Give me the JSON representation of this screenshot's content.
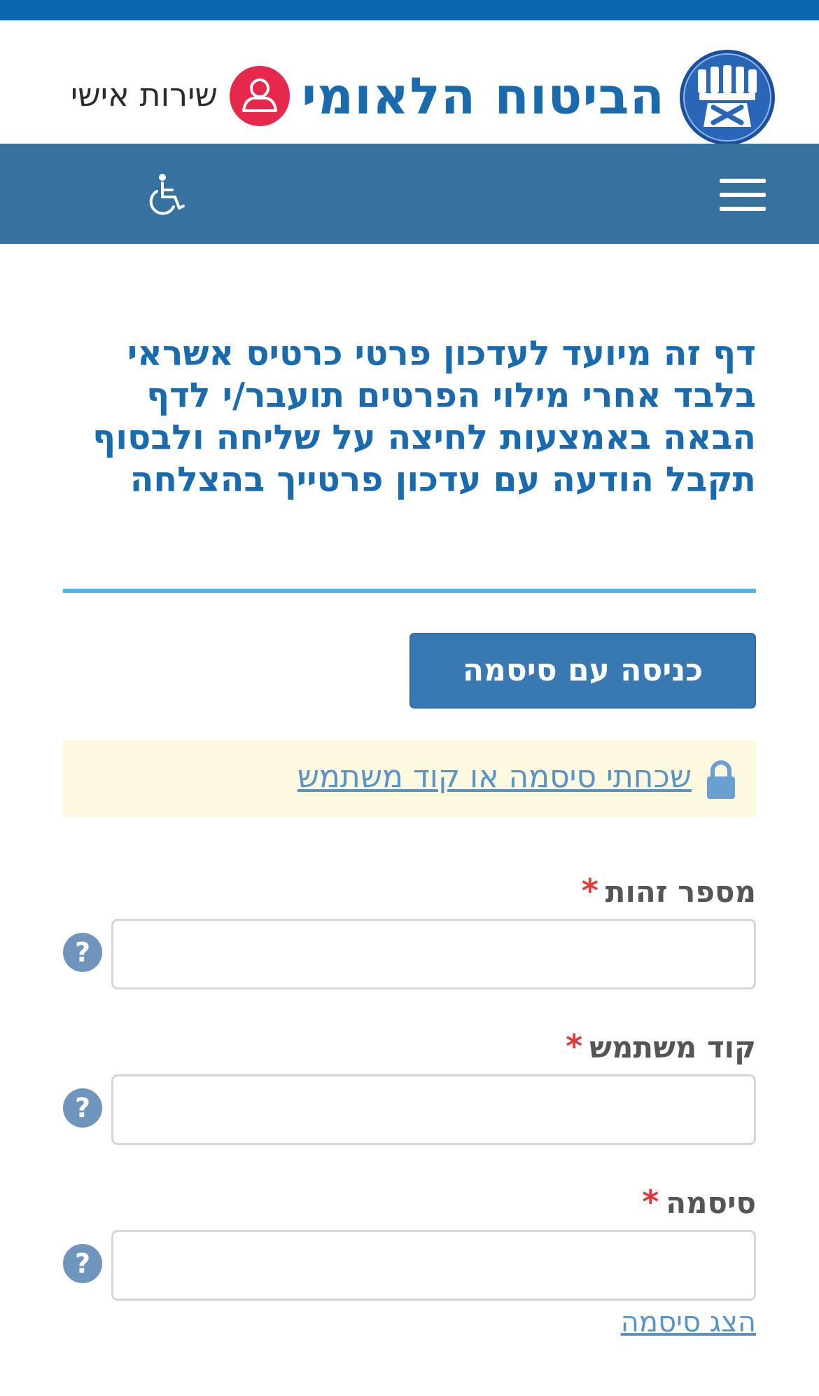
{
  "header": {
    "brand_title": "הביטוח הלאומי",
    "personal_service_label": "שירות אישי",
    "logo_icon": "national-insurance-emblem-icon",
    "personal_icon": "user-icon"
  },
  "navbar": {
    "menu_icon": "hamburger-menu-icon",
    "accessibility_icon": "wheelchair-icon"
  },
  "intro": {
    "text": "דף זה מיועד לעדכון פרטי כרטיס אשראי בלבד אחרי מילוי הפרטים תועבר/י לדף הבאה באמצעות לחיצה על שליחה ולבסוף תקבל הודעה עם עדכון פרטייך בהצלחה"
  },
  "login": {
    "button_label": "כניסה עם סיסמה"
  },
  "forgot": {
    "link_label": "שכחתי סיסמה או קוד משתמש",
    "icon": "lock-icon"
  },
  "form": {
    "required_mark": "*",
    "fields": [
      {
        "label": "מספר זהות",
        "value": "",
        "placeholder": ""
      },
      {
        "label": "קוד משתמש",
        "value": "",
        "placeholder": ""
      },
      {
        "label": "סיסמה",
        "value": "",
        "placeholder": ""
      }
    ],
    "show_password_label": "הצג סיסמה"
  },
  "colors": {
    "brand_blue": "#1a6aae",
    "nav_blue": "#3671a0",
    "divider": "#4db8e6",
    "personal_red": "#e5284c",
    "required_red": "#e03a3a",
    "link_blue": "#5a93c6",
    "notice_bg": "#fdf9e1"
  }
}
